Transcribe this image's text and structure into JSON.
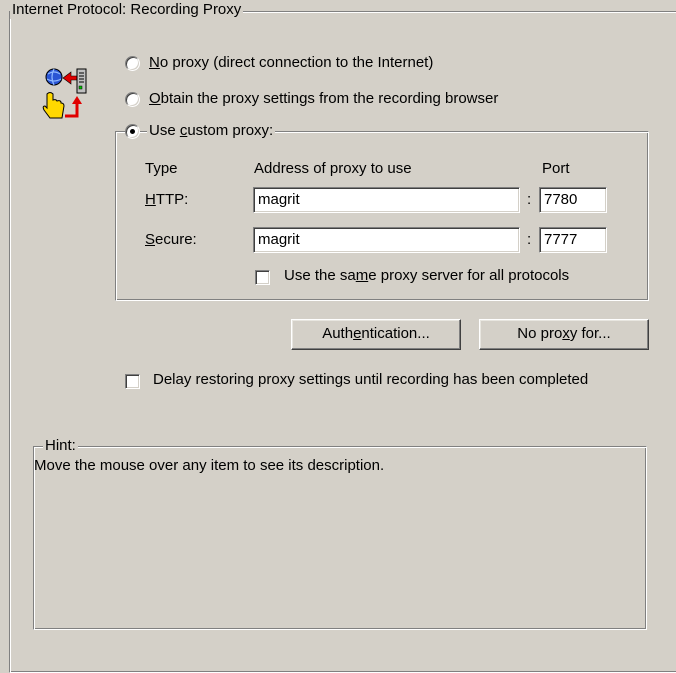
{
  "section": {
    "title": "Internet Protocol: Recording Proxy"
  },
  "proxy_options": {
    "no_proxy": {
      "prefix": "",
      "key": "N",
      "suffix": "o proxy (direct connection to the Internet)",
      "selected": false
    },
    "obtain": {
      "prefix": "",
      "key": "O",
      "suffix": "btain the proxy settings from the recording browser",
      "selected": false
    },
    "custom": {
      "prefix": "Use ",
      "key": "c",
      "suffix": "ustom proxy:",
      "selected": true
    }
  },
  "custom_proxy": {
    "col_type": "Type",
    "col_address": "Address of proxy to use",
    "col_port": "Port",
    "http": {
      "prefix": "",
      "key": "H",
      "suffix": "TTP:",
      "address": "magrit",
      "separator": ":",
      "port": "7780"
    },
    "secure": {
      "prefix": "",
      "key": "S",
      "suffix": "ecure:",
      "address": "magrit",
      "separator": ":",
      "port": "7777"
    },
    "same_proxy": {
      "prefix": "Use the sa",
      "key": "m",
      "suffix": "e proxy server for all protocols",
      "checked": false
    }
  },
  "buttons": {
    "authentication": {
      "prefix": "Auth",
      "key": "e",
      "suffix": "ntication..."
    },
    "no_proxy_for": {
      "prefix": "No pro",
      "key": "x",
      "suffix": "y for..."
    }
  },
  "delay_restore": {
    "label": "Delay restoring proxy settings until recording has been completed",
    "checked": false
  },
  "hint": {
    "title": "Hint:",
    "text": "Move the mouse over any item to see its description."
  },
  "icons": {
    "proxy": "proxy-settings-icon"
  }
}
